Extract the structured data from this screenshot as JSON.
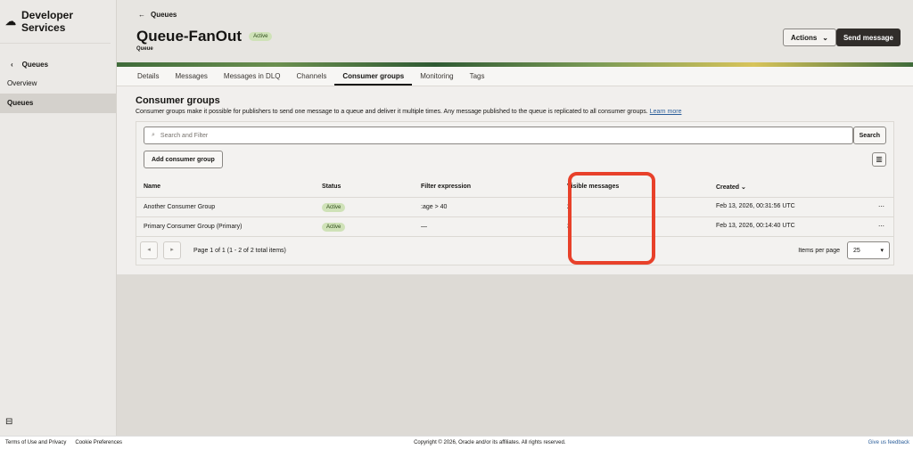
{
  "brand": "Developer Services",
  "sidebar": {
    "back": "Queues",
    "items": [
      "Overview",
      "Queues"
    ]
  },
  "header": {
    "breadcrumb": "Queues",
    "title": "Queue-FanOut",
    "status": "Active",
    "subtitle": "Queue",
    "actions": "Actions",
    "send": "Send message"
  },
  "tabs": [
    "Details",
    "Messages",
    "Messages in DLQ",
    "Channels",
    "Consumer groups",
    "Monitoring",
    "Tags"
  ],
  "section": {
    "title": "Consumer groups",
    "description": "Consumer groups make it possible for publishers to send one message to a queue and deliver it multiple times. Any message published to the queue is replicated to all consumer groups.",
    "learn_more": "Learn more"
  },
  "search": {
    "placeholder": "Search and Filter",
    "button": "Search"
  },
  "add_button": "Add consumer group",
  "table": {
    "headers": [
      "Name",
      "Status",
      "Filter expression",
      "Visible messages",
      "Created"
    ],
    "rows": [
      {
        "name": "Another Consumer Group",
        "status": "Active",
        "filter": ":age > 40",
        "visible": "2",
        "created": "Feb 13, 2026, 00:31:56 UTC"
      },
      {
        "name": "Primary Consumer Group (Primary)",
        "status": "Active",
        "filter": "—",
        "visible": "3",
        "created": "Feb 13, 2026, 00:14:40 UTC"
      }
    ]
  },
  "pager": {
    "text": "Page 1 of 1 (1 - 2 of 2 total items)",
    "items_per_page_label": "Items per page",
    "items_per_page": "25"
  },
  "footer": {
    "terms": "Terms of Use and Privacy",
    "cookies": "Cookie Preferences",
    "copyright": "Copyright © 2026, Oracle and/or its affiliates. All rights reserved.",
    "feedback": "Give us feedback"
  }
}
